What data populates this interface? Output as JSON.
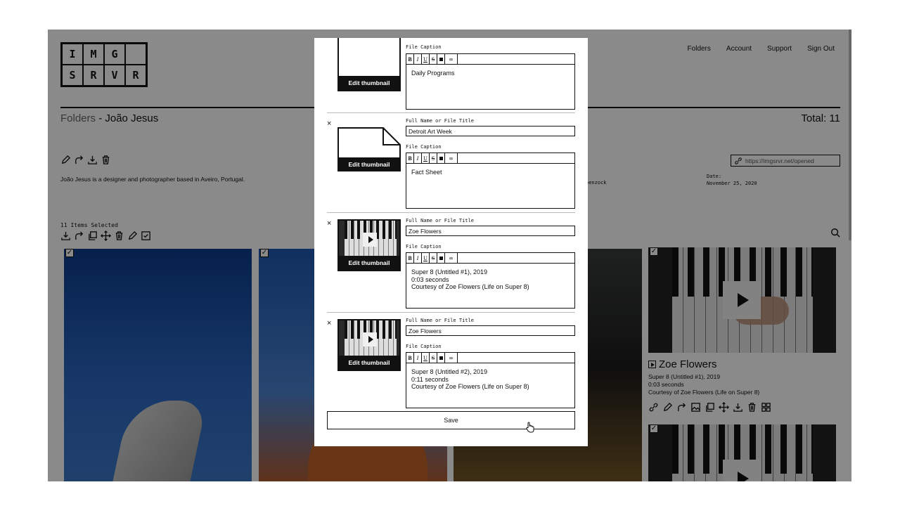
{
  "logo": {
    "letters": [
      "I",
      "M",
      "G",
      "",
      "S",
      "R",
      "V",
      "R"
    ]
  },
  "nav": {
    "folders": "Folders",
    "account": "Account",
    "support": "Support",
    "sign_out": "Sign Out"
  },
  "folder": {
    "prefix": "Folders",
    "separator": " - ",
    "owner": "João Jesus",
    "total": "Total: 11"
  },
  "bio": "João Jesus is a designer and photographer based in Aveiro, Portugal.",
  "author_fragment": "oenzock",
  "date": {
    "label": "Date:",
    "value": "November 25, 2020"
  },
  "share_url": "https://imgsrvr.net/opened",
  "selection": {
    "label": "11 Items Selected"
  },
  "video_card": {
    "title": "Zoe Flowers",
    "caption_line1": "Super 8 (Untitled #1), 2019",
    "caption_line2": "0:03 seconds",
    "caption_line3": "Courtesy of Zoe Flowers (Life on Super 8)"
  },
  "modal": {
    "title_label": "Full Name or File Title",
    "caption_label": "File Caption",
    "edit_thumbnail": "Edit thumbnail",
    "close_glyph": "×",
    "toolbar": {
      "bold": "B",
      "italic": "I",
      "underline": "U",
      "strike": "S",
      "link": "∞"
    },
    "entries": [
      {
        "title": "",
        "caption": [
          "Daily Programs"
        ]
      },
      {
        "title": "Detroit Art Week",
        "caption": [
          "Fact Sheet"
        ]
      },
      {
        "title": "Zoe Flowers",
        "caption": [
          "Super 8 (Untitled #1), 2019",
          "0:03 seconds",
          "Courtesy of Zoe Flowers (Life on Super 8)"
        ]
      },
      {
        "title": "Zoe Flowers",
        "caption": [
          "Super 8 (Untitled #2), 2019",
          "0:11 seconds",
          "Courtesy of Zoe Flowers (Life on Super 8)"
        ]
      }
    ],
    "save_label": "Save"
  },
  "icons": {
    "toolbar_a": [
      "pencil-icon",
      "share-icon",
      "download-icon",
      "trash-icon"
    ],
    "toolbar_b": [
      "download-icon",
      "share-icon",
      "copy-icon",
      "move-icon",
      "trash-icon",
      "pencil-icon",
      "checkbox-icon"
    ],
    "card_actions": [
      "link-icon",
      "pencil-icon",
      "share-icon",
      "image-icon",
      "copy-icon",
      "move-icon",
      "download-icon",
      "trash-icon",
      "grid-icon"
    ]
  },
  "colors": {
    "overlay": "#000000",
    "accent": "#111111"
  }
}
